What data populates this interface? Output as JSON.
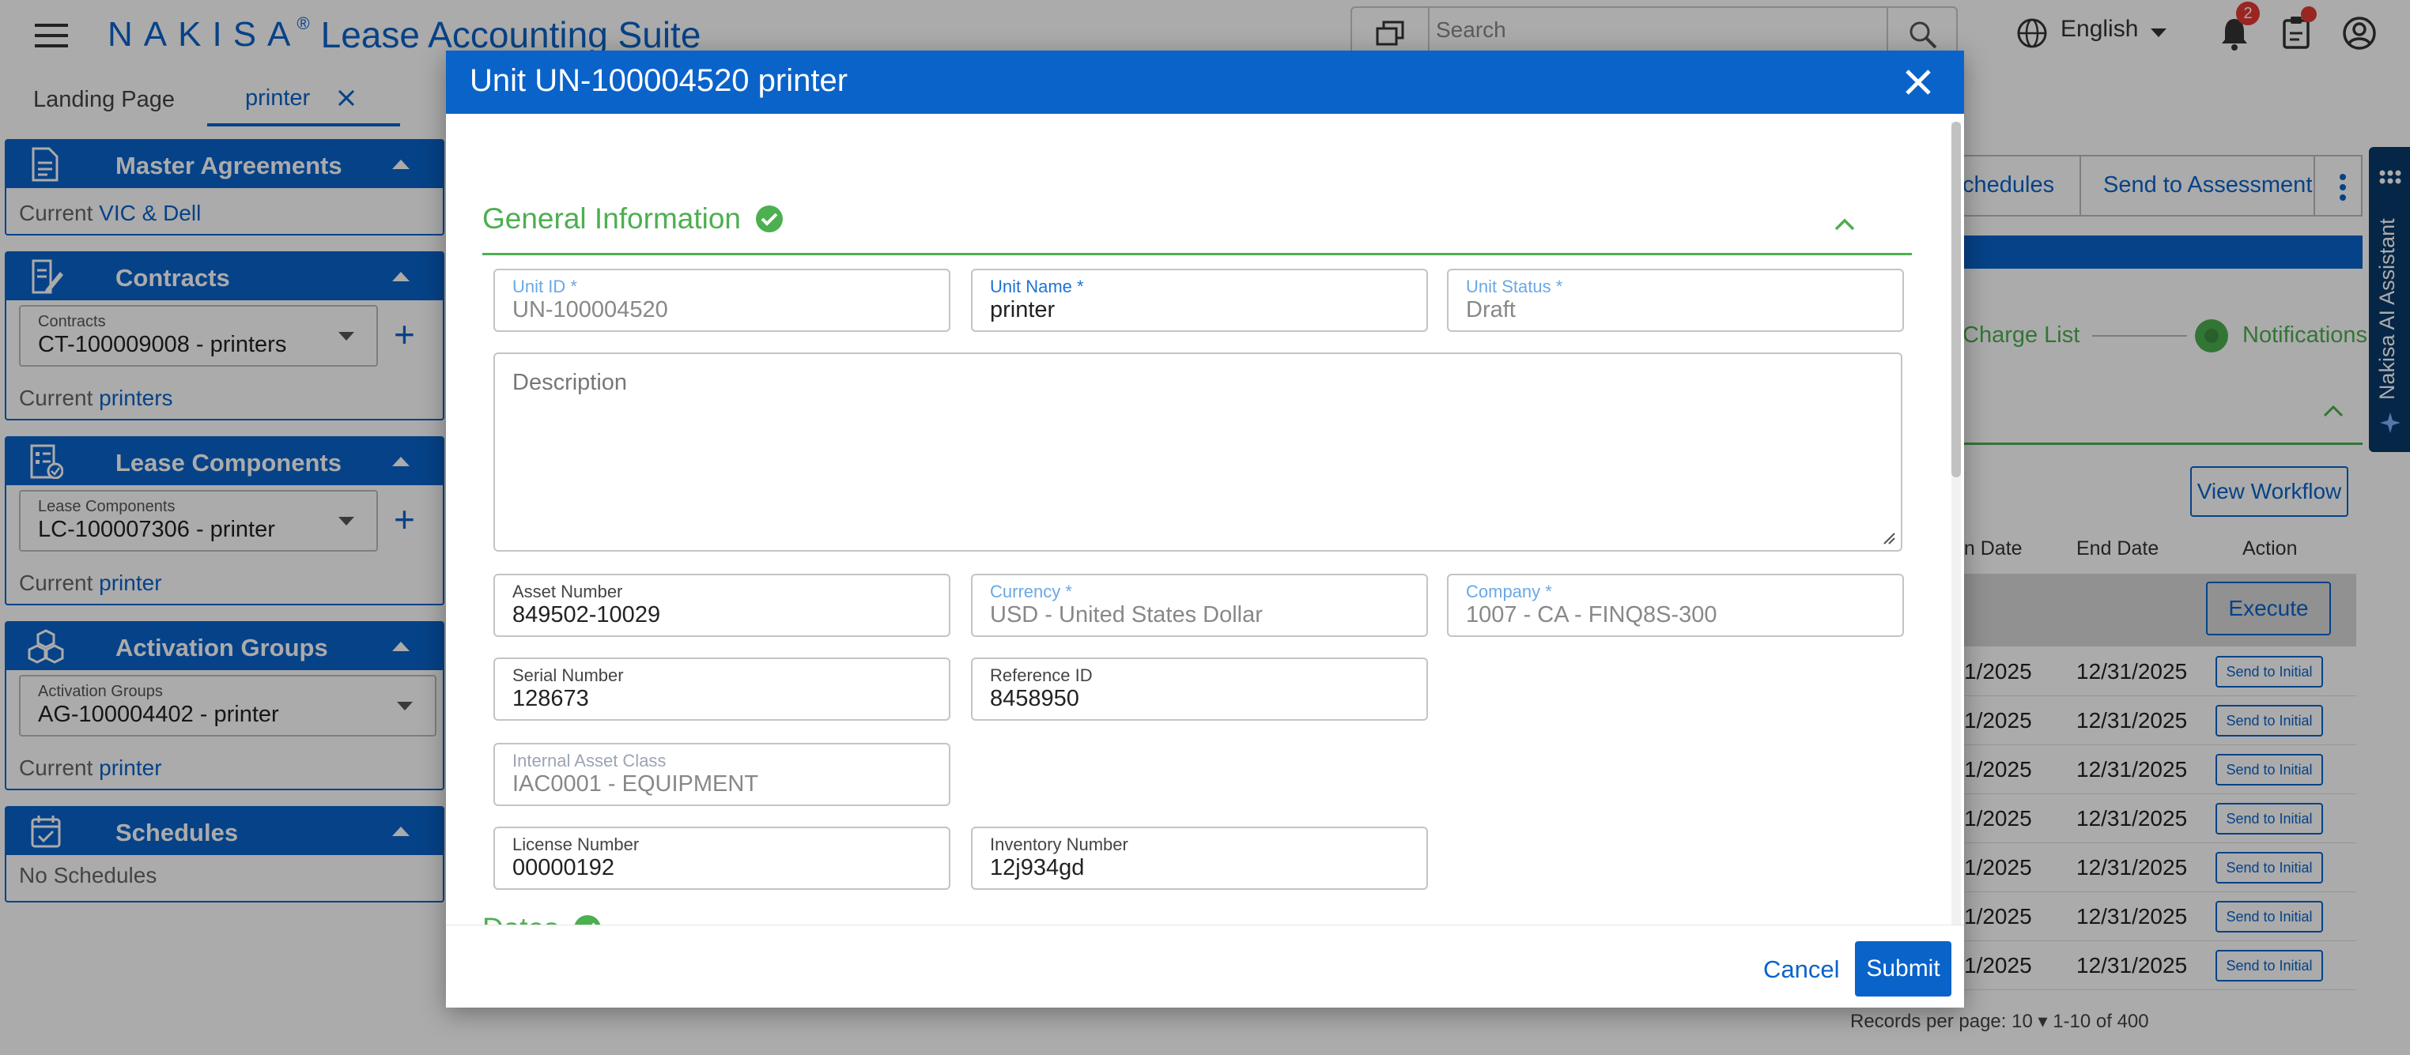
{
  "header": {
    "brand_nakisa": "NAKISA",
    "brand_reg": "®",
    "brand_suite": "Lease Accounting Suite",
    "search_placeholder": "Search",
    "language": "English",
    "notification_count": "2"
  },
  "tabs": [
    {
      "label": "Landing Page"
    },
    {
      "label": "printer"
    }
  ],
  "sidebar": {
    "master": {
      "title": "Master Agreements",
      "current_label": "Current",
      "current_value": "VIC & Dell"
    },
    "contracts": {
      "title": "Contracts",
      "select_label": "Contracts",
      "select_value": "CT-100009008 - printers",
      "current_label": "Current",
      "current_value": "printers"
    },
    "lease": {
      "title": "Lease Components",
      "select_label": "Lease Components",
      "select_value": "LC-100007306 - printer",
      "current_label": "Current",
      "current_value": "printer"
    },
    "activation": {
      "title": "Activation Groups",
      "select_label": "Activation Groups",
      "select_value": "AG-100004402 - printer",
      "current_label": "Current",
      "current_value": "printer"
    },
    "schedules": {
      "title": "Schedules",
      "empty": "No Schedules"
    }
  },
  "background": {
    "btn_schedules": "chedules",
    "btn_send_assessment": "Send to Assessment",
    "charge_list": "Charge List",
    "notifications": "Notifications",
    "view_workflow": "View Workflow",
    "col_start": "on Date",
    "col_end": "End Date",
    "col_action": "Action",
    "execute": "Execute",
    "rows": [
      {
        "start": "1/2025",
        "end": "12/31/2025",
        "action": "Send to Initial"
      },
      {
        "start": "1/2025",
        "end": "12/31/2025",
        "action": "Send to Initial"
      },
      {
        "start": "1/2025",
        "end": "12/31/2025",
        "action": "Send to Initial"
      },
      {
        "start": "1/2025",
        "end": "12/31/2025",
        "action": "Send to Initial"
      },
      {
        "start": "1/2025",
        "end": "12/31/2025",
        "action": "Send to Initial"
      },
      {
        "start": "1/2025",
        "end": "12/31/2025",
        "action": "Send to Initial"
      },
      {
        "start": "1/2025",
        "end": "12/31/2025",
        "action": "Send to Initial"
      }
    ],
    "pager": "Records per page:  10   ▾      1-10 of 400",
    "ai_assistant": "Nakisa AI Assistant"
  },
  "modal": {
    "title": "Unit UN-100004520 printer",
    "sections": {
      "general": "General Information",
      "dates": "Dates"
    },
    "fields": {
      "unit_id": {
        "label": "Unit ID *",
        "value": "UN-100004520"
      },
      "unit_name": {
        "label": "Unit Name *",
        "value": "printer"
      },
      "unit_status": {
        "label": "Unit Status *",
        "value": "Draft"
      },
      "description": {
        "placeholder": "Description"
      },
      "asset_number": {
        "label": "Asset Number",
        "value": "849502-10029"
      },
      "currency": {
        "label": "Currency *",
        "value": "USD - United States Dollar"
      },
      "company": {
        "label": "Company *",
        "value": "1007 - CA - FINQ8S-300"
      },
      "serial_number": {
        "label": "Serial Number",
        "value": "128673"
      },
      "reference_id": {
        "label": "Reference ID",
        "value": "8458950"
      },
      "internal_asset_class": {
        "label": "Internal Asset Class",
        "value": "IAC0001 - EQUIPMENT"
      },
      "license_number": {
        "label": "License Number",
        "value": "00000192"
      },
      "inventory_number": {
        "label": "Inventory Number",
        "value": "12j934gd"
      }
    },
    "buttons": {
      "cancel": "Cancel",
      "submit": "Submit"
    }
  },
  "colors": {
    "primary": "#0a63c9",
    "success": "#4caf50",
    "header_dark": "#083a6b"
  }
}
